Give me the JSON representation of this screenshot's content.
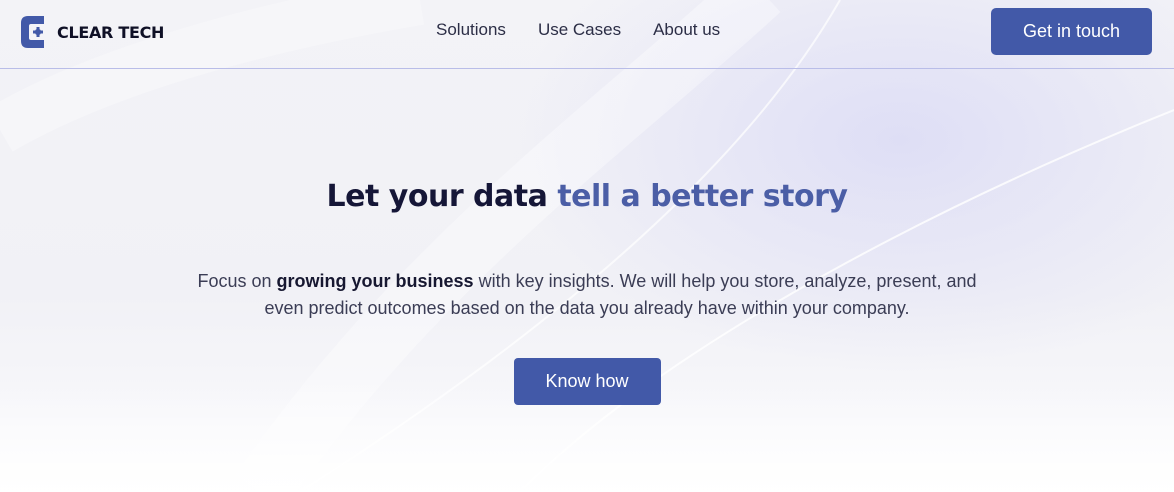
{
  "brand": {
    "name": "CLEAR TECH",
    "logo_letter": "C"
  },
  "nav": {
    "items": [
      {
        "label": "Solutions"
      },
      {
        "label": "Use Cases"
      },
      {
        "label": "About us"
      }
    ],
    "cta_label": "Get in touch"
  },
  "hero": {
    "title_main": "Let your data ",
    "title_accent": "tell a better story",
    "text_before": "Focus on ",
    "text_bold": "growing your business",
    "text_after": " with key insights. We will help you store, analyze, present, and even predict outcomes based on the data you already have within your company.",
    "button_label": "Know how"
  },
  "colors": {
    "primary": "#4259a8",
    "accent_text": "#4b5ea6",
    "heading": "#151637",
    "body_text": "#3b3d55",
    "divider": "#b9bde8"
  }
}
